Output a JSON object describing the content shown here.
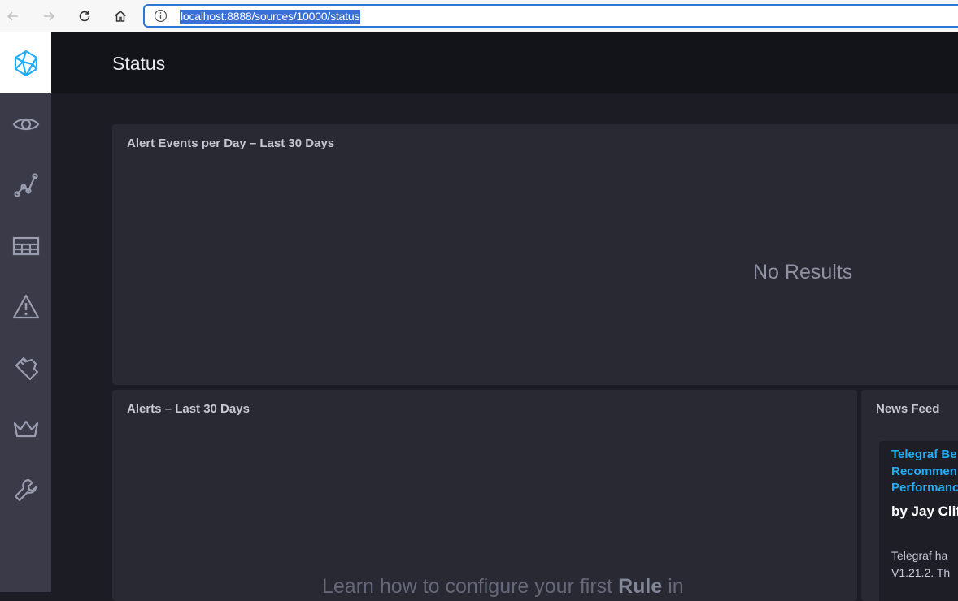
{
  "browser": {
    "url": "localhost:8888/sources/10000/status"
  },
  "sidebar": {
    "items": [
      {
        "icon": "eye-icon"
      },
      {
        "icon": "graph-icon"
      },
      {
        "icon": "table-icon"
      },
      {
        "icon": "alert-icon"
      },
      {
        "icon": "plug-icon"
      },
      {
        "icon": "crown-icon"
      },
      {
        "icon": "wrench-icon"
      }
    ]
  },
  "header": {
    "title": "Status"
  },
  "alert_events_panel": {
    "title": "Alert Events per Day – Last 30 Days",
    "empty_text": "No Results"
  },
  "alerts_panel": {
    "title": "Alerts – Last 30 Days",
    "empty_text_prefix": "Learn how to configure your first ",
    "empty_text_bold": "Rule",
    "empty_text_suffix": " in"
  },
  "news_panel": {
    "title": "News Feed",
    "item": {
      "title": "Telegraf Be\nRecommen\nPerformanc",
      "author": "by Jay Clif",
      "body": "Telegraf ha\nV1.21.2. Th"
    }
  },
  "colors": {
    "accent": "#22adf6",
    "sidebar_bg": "#3a3a48",
    "header_bg": "#13131a",
    "page_bg": "#1c1c25",
    "panel_bg": "#292934"
  }
}
